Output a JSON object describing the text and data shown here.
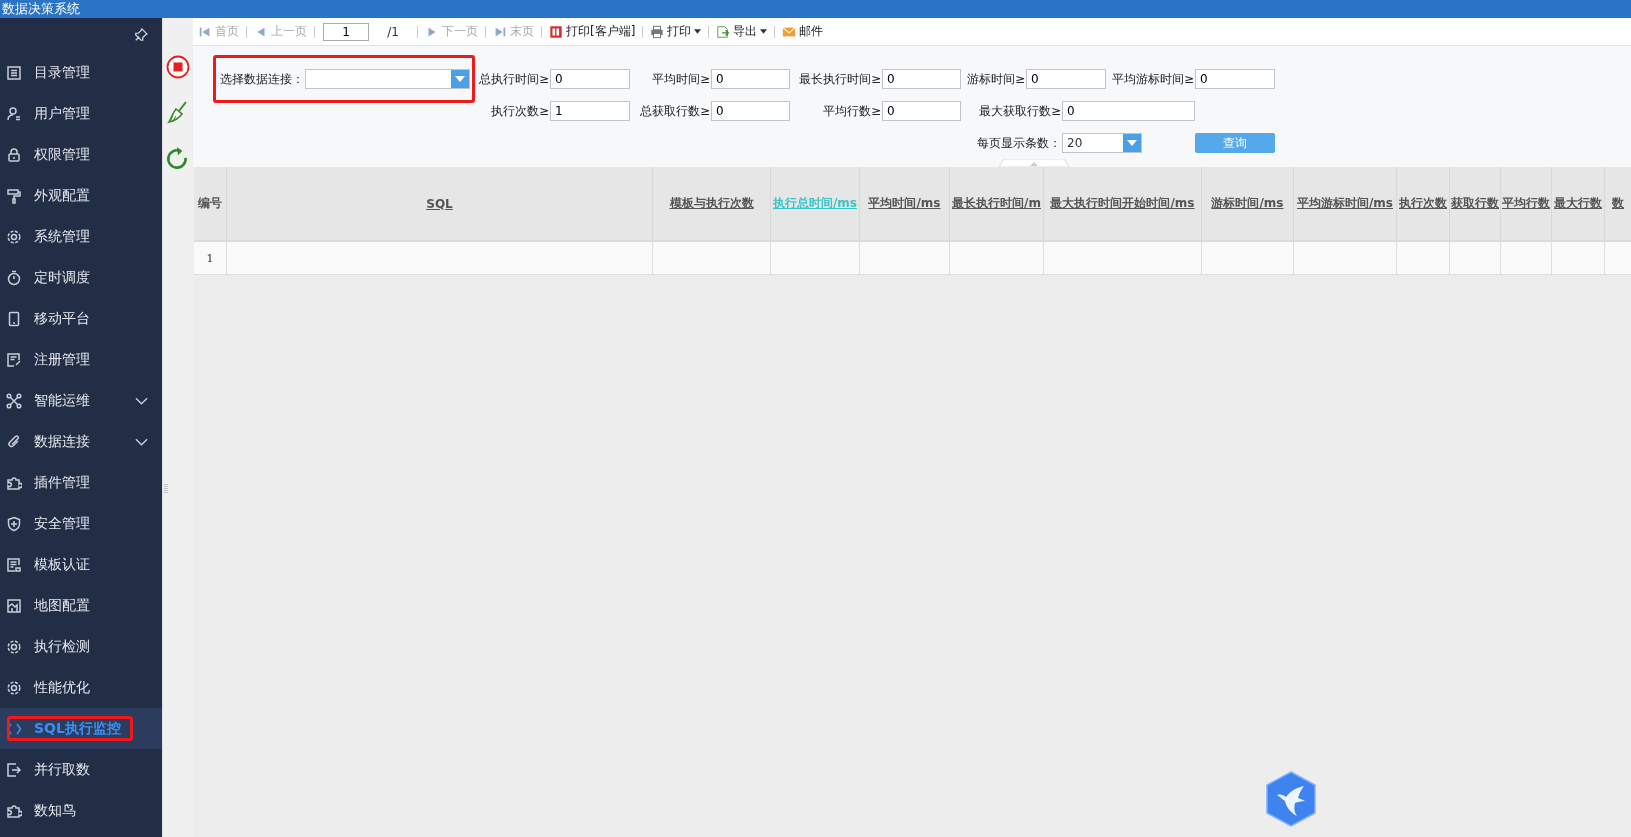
{
  "app": {
    "title": "数据决策系统"
  },
  "sidebar": {
    "items": [
      {
        "label": "目录管理",
        "selected": false,
        "expandable": false
      },
      {
        "label": "用户管理",
        "selected": false,
        "expandable": false
      },
      {
        "label": "权限管理",
        "selected": false,
        "expandable": false
      },
      {
        "label": "外观配置",
        "selected": false,
        "expandable": false
      },
      {
        "label": "系统管理",
        "selected": false,
        "expandable": false
      },
      {
        "label": "定时调度",
        "selected": false,
        "expandable": false
      },
      {
        "label": "移动平台",
        "selected": false,
        "expandable": false
      },
      {
        "label": "注册管理",
        "selected": false,
        "expandable": false
      },
      {
        "label": "智能运维",
        "selected": false,
        "expandable": true
      },
      {
        "label": "数据连接",
        "selected": false,
        "expandable": true
      },
      {
        "label": "插件管理",
        "selected": false,
        "expandable": false
      },
      {
        "label": "安全管理",
        "selected": false,
        "expandable": false
      },
      {
        "label": "模板认证",
        "selected": false,
        "expandable": false
      },
      {
        "label": "地图配置",
        "selected": false,
        "expandable": false
      },
      {
        "label": "执行检测",
        "selected": false,
        "expandable": false
      },
      {
        "label": "性能优化",
        "selected": false,
        "expandable": false
      },
      {
        "label": "SQL执行监控",
        "selected": true,
        "expandable": false
      },
      {
        "label": "并行取数",
        "selected": false,
        "expandable": false
      },
      {
        "label": "数知鸟",
        "selected": false,
        "expandable": false
      }
    ]
  },
  "toolbar": {
    "items": [
      {
        "kind": "button",
        "label": "首页",
        "disabled": true
      },
      {
        "kind": "button",
        "label": "上一页",
        "disabled": true
      },
      {
        "kind": "page",
        "value": "1"
      },
      {
        "kind": "text",
        "label": "/1"
      },
      {
        "kind": "button",
        "label": "下一页",
        "disabled": true
      },
      {
        "kind": "button",
        "label": "末页",
        "disabled": true
      },
      {
        "kind": "button",
        "label": "打印[客户端]",
        "disabled": false
      },
      {
        "kind": "menu",
        "label": "打印",
        "disabled": false
      },
      {
        "kind": "menu",
        "label": "导出",
        "disabled": false
      },
      {
        "kind": "button",
        "label": "邮件",
        "disabled": false
      }
    ]
  },
  "filters": {
    "fields": [
      {
        "kind": "combo",
        "label": "选择数据连接："
      },
      {
        "kind": "input",
        "label": "总执行时间≥",
        "value": "0"
      },
      {
        "kind": "input",
        "label": "平均时间≥",
        "value": "0"
      },
      {
        "kind": "input",
        "label": "最长执行时间≥",
        "value": "0"
      },
      {
        "kind": "input",
        "label": "游标时间≥",
        "value": "0"
      },
      {
        "kind": "input",
        "label": "平均游标时间≥",
        "value": "0"
      },
      {
        "kind": "input",
        "label": "执行次数≥",
        "value": "1"
      },
      {
        "kind": "input",
        "label": "总获取行数≥",
        "value": "0"
      },
      {
        "kind": "input",
        "label": "平均行数≥",
        "value": "0"
      },
      {
        "kind": "input",
        "label": "最大获取行数≥",
        "value": "0"
      },
      {
        "kind": "combo",
        "label": "每页显示条数：",
        "value": "20"
      },
      {
        "kind": "button",
        "label": "查询"
      }
    ]
  },
  "table": {
    "columns": [
      {
        "label": "编号",
        "sorted": false
      },
      {
        "label": "SQL",
        "sorted": false
      },
      {
        "label": "模板与执行次数",
        "sorted": false
      },
      {
        "label": "执行总时间/ms",
        "sorted": true
      },
      {
        "label": "平均时间/ms",
        "sorted": false
      },
      {
        "label": "最长执行时间/m",
        "sorted": false
      },
      {
        "label": "最大执行时间开始时间/ms",
        "sorted": false
      },
      {
        "label": "游标时间/ms",
        "sorted": false
      },
      {
        "label": "平均游标时间/ms",
        "sorted": false
      },
      {
        "label": "执行次数",
        "sorted": false
      },
      {
        "label": "获取行数",
        "sorted": false
      },
      {
        "label": "平均行数",
        "sorted": false
      },
      {
        "label": "最大行数",
        "sorted": false
      },
      {
        "label": "数",
        "sorted": false
      }
    ],
    "rows": [
      {
        "number": "1"
      }
    ]
  }
}
